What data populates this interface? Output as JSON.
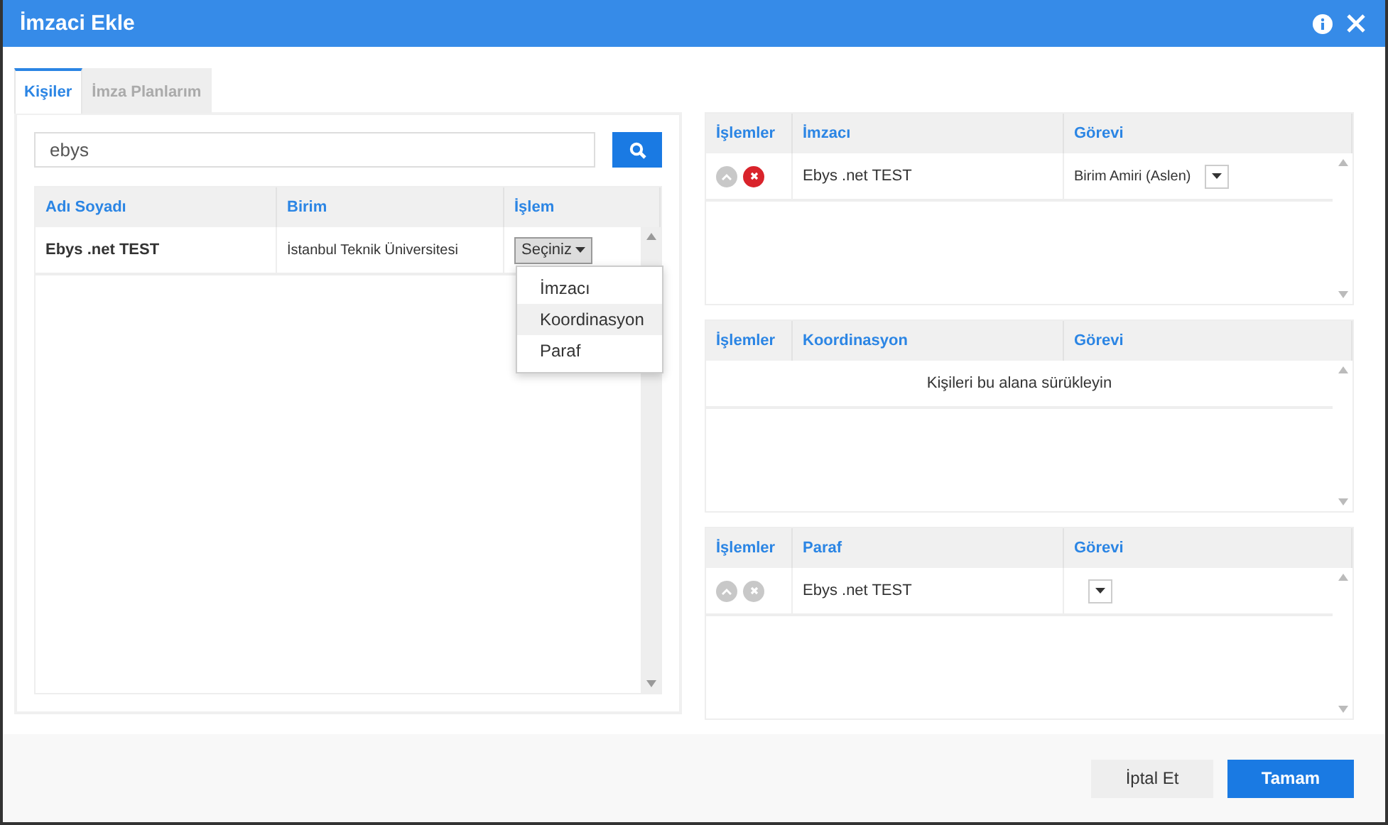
{
  "dialog": {
    "title": "İmzaci Ekle"
  },
  "tabs": [
    {
      "label": "Kişiler",
      "selected": true
    },
    {
      "label": "İmza Planlarım",
      "selected": false
    }
  ],
  "search": {
    "value": "ebys"
  },
  "people_table": {
    "columns": [
      "Adı Soyadı",
      "Birim",
      "İşlem"
    ],
    "rows": [
      {
        "name": "Ebys .net TEST",
        "unit": "İstanbul Teknik Üniversitesi",
        "action": "Seçiniz"
      }
    ],
    "dropdown": [
      {
        "label": "İmzacı",
        "selected": false
      },
      {
        "label": "Koordinasyon",
        "selected": true
      },
      {
        "label": "Paraf",
        "selected": false
      }
    ]
  },
  "assignment_tables": [
    {
      "columns": [
        "İşlemler",
        "İmzacı",
        "Görevi"
      ],
      "rows": [
        {
          "name": "Ebys .net TEST",
          "role": "Birim Amiri (Aslen)",
          "remove_enabled": true
        }
      ]
    },
    {
      "columns": [
        "İşlemler",
        "Koordinasyon",
        "Görevi"
      ],
      "empty_message": "Kişileri bu alana sürükleyin"
    },
    {
      "columns": [
        "İşlemler",
        "Paraf",
        "Görevi"
      ],
      "rows": [
        {
          "name": "Ebys .net TEST",
          "remove_enabled": false
        }
      ]
    }
  ],
  "buttons": [
    {
      "label": "İptal Et",
      "kind": "secondary"
    },
    {
      "label": "Tamam",
      "kind": "primary"
    }
  ]
}
